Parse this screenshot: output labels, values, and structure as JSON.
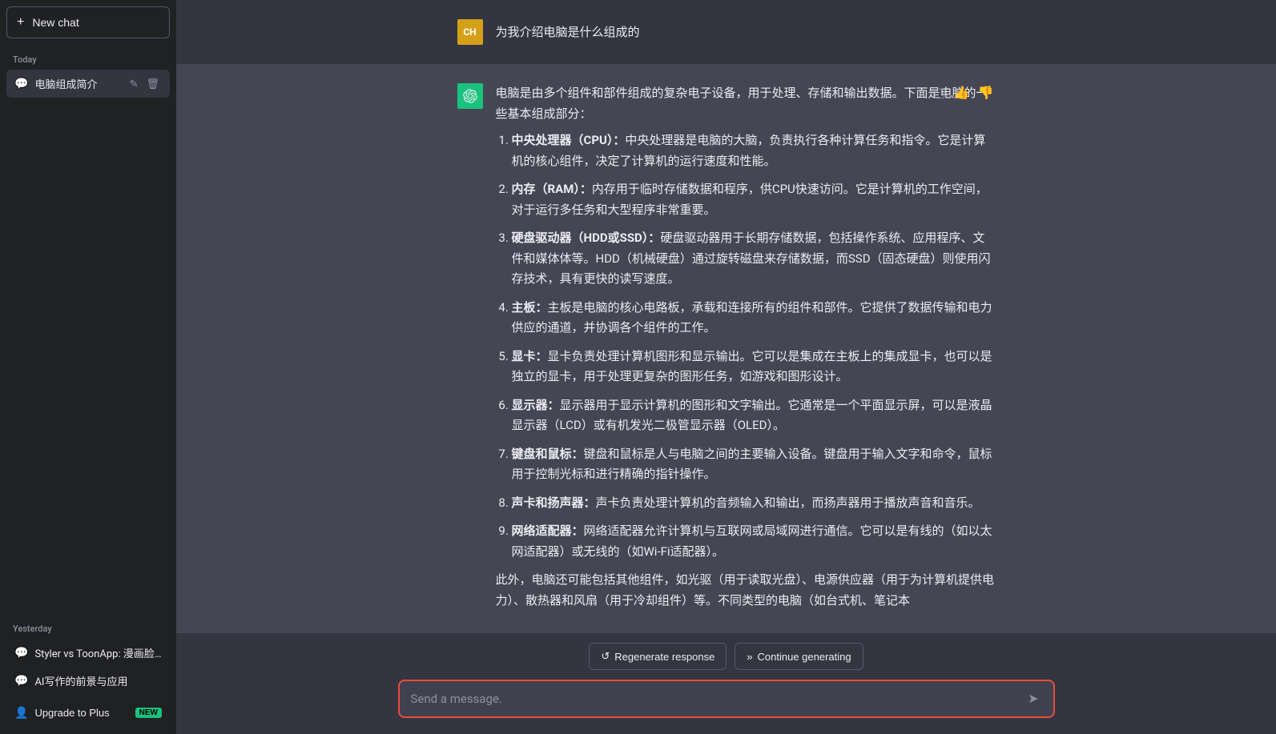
{
  "sidebar": {
    "new_chat_label": "New chat",
    "new_chat_icon": "+",
    "today_label": "Today",
    "today_items": [
      {
        "id": "computer-intro",
        "label": "电脑组成简介",
        "active": true
      }
    ],
    "yesterday_label": "Yesterday",
    "yesterday_items": [
      {
        "id": "styler-toonapp",
        "label": "Styler vs ToonApp: 漫画脸优差"
      },
      {
        "id": "ai-writing",
        "label": "AI写作的前景与应用"
      }
    ],
    "upgrade_label": "Upgrade to Plus",
    "upgrade_badge": "NEW",
    "upgrade_icon": "person"
  },
  "chat": {
    "user_avatar_initials": "CH",
    "user_question": "为我介绍电脑是什么组成的",
    "ai_intro": "电脑是由多个组件和部件组成的复杂电子设备，用于处理、存储和输出数据。下面是电脑的一些基本组成部分：",
    "ai_items": [
      {
        "index": 1,
        "title": "中央处理器（CPU）",
        "content": "中央处理器是电脑的大脑，负责执行各种计算任务和指令。它是计算机的核心组件，决定了计算机的运行速度和性能。"
      },
      {
        "index": 2,
        "title": "内存（RAM）",
        "content": "内存用于临时存储数据和程序，供CPU快速访问。它是计算机的工作空间，对于运行多任务和大型程序非常重要。"
      },
      {
        "index": 3,
        "title": "硬盘驱动器（HDD或SSD）",
        "content": "硬盘驱动器用于长期存储数据，包括操作系统、应用程序、文件和媒体体等。HDD（机械硬盘）通过旋转磁盘来存储数据，而SSD（固态硬盘）则使用闪存技术，具有更快的读写速度。"
      },
      {
        "index": 4,
        "title": "主板",
        "content": "主板是电脑的核心电路板，承载和连接所有的组件和部件。它提供了数据传输和电力供应的通道，并协调各个组件的工作。"
      },
      {
        "index": 5,
        "title": "显卡",
        "content": "显卡负责处理计算机图形和显示输出。它可以是集成在主板上的集成显卡，也可以是独立的显卡，用于处理更复杂的图形任务，如游戏和图形设计。"
      },
      {
        "index": 6,
        "title": "显示器",
        "content": "显示器用于显示计算机的图形和文字输出。它通常是一个平面显示屏，可以是液晶显示器（LCD）或有机发光二极管显示器（OLED）。"
      },
      {
        "index": 7,
        "title": "键盘和鼠标",
        "content": "键盘和鼠标是人与电脑之间的主要输入设备。键盘用于输入文字和命令，鼠标用于控制光标和进行精确的指针操作。"
      },
      {
        "index": 8,
        "title": "声卡和扬声器",
        "content": "声卡负责处理计算机的音频输入和输出，而扬声器用于播放声音和音乐。"
      },
      {
        "index": 9,
        "title": "网络适配器",
        "content": "网络适配器允许计算机与互联网或局域网进行通信。它可以是有线的（如以太网适配器）或无线的（如Wi-Fi适配器）。"
      }
    ],
    "ai_footer": "此外，电脑还可能包括其他组件，如光驱（用于读取光盘）、电源供应器（用于为计算机提供电力）、散热器和风扇（用于冷却组件）等。不同类型的电脑（如台式机、笔记本"
  },
  "bottom": {
    "regenerate_label": "Regenerate response",
    "continue_label": "Continue generating",
    "regenerate_icon": "↺",
    "continue_icon": "»",
    "input_placeholder": "Send a message.",
    "send_icon": "➤"
  }
}
